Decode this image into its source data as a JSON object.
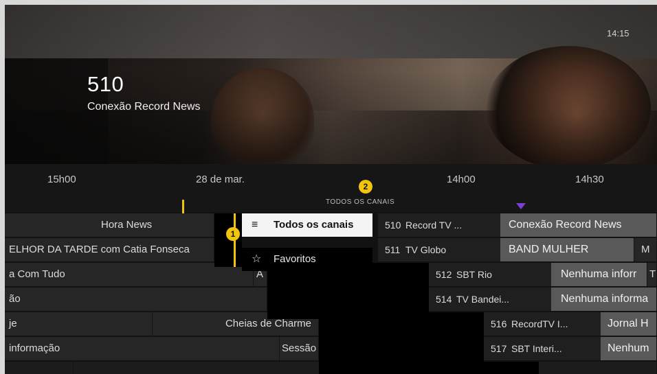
{
  "header": {
    "clock": "14:15",
    "channel_number": "510",
    "channel_name": "Conexão Record News"
  },
  "timeline": {
    "left_time": "15h00",
    "date": "28 de mar.",
    "time_1": "14h00",
    "time_2": "14h30",
    "overlay_label": "TODOS OS CANAIS"
  },
  "badges": {
    "one": "1",
    "two": "2"
  },
  "menu": {
    "items": [
      {
        "label": "Todos os canais",
        "icon": "list-icon"
      },
      {
        "label": "Favoritos",
        "icon": "star-icon"
      }
    ]
  },
  "grid": {
    "left_rows": [
      [
        "Hora News"
      ],
      [
        "ELHOR DA TARDE com Catia Fonseca"
      ],
      [
        "a Com Tudo",
        "A"
      ],
      [
        "ão"
      ],
      [
        "je",
        "Cheias de Charme"
      ],
      [
        " informação",
        "Sessão"
      ]
    ],
    "channels": [
      {
        "number": "510",
        "name": "Record TV ...",
        "program": "Conexão Record News"
      },
      {
        "number": "511",
        "name": "TV Globo",
        "program": "BAND MULHER",
        "next": "M"
      },
      {
        "number": "512",
        "name": "SBT Rio",
        "program": "Nenhuma inforr",
        "next": "T"
      },
      {
        "number": "514",
        "name": "TV Bandei...",
        "program": "Nenhuma informa"
      },
      {
        "number": "516",
        "name": "RecordTV I...",
        "program": "Jornal H"
      },
      {
        "number": "517",
        "name": "SBT Interi...",
        "program": "Nenhum"
      }
    ]
  },
  "colors": {
    "badge": "#f1c40f",
    "now_marker": "#7b3fd6",
    "selected_menu_bg": "#f4f4f4",
    "highlight_cell": "#595959"
  }
}
